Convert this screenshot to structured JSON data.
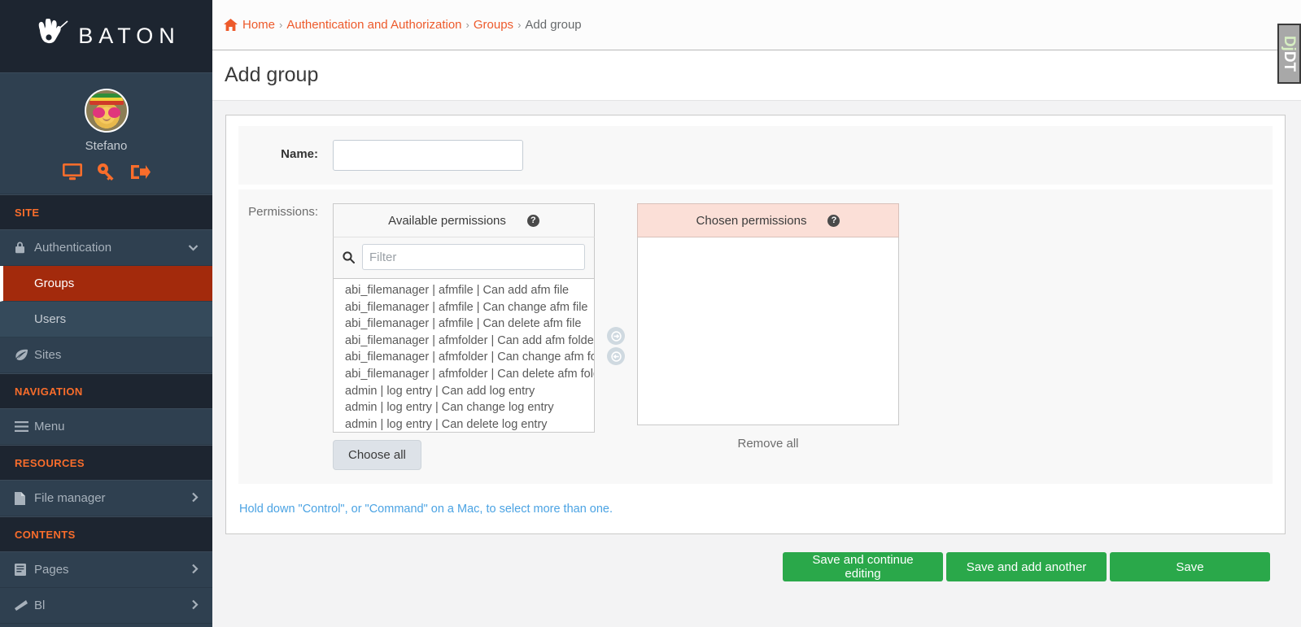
{
  "brand": {
    "name": "BATON",
    "logo_icon": "hand-baton-icon"
  },
  "profile": {
    "name": "Stefano",
    "avatar_icon": "user-avatar",
    "actions": [
      {
        "name": "view-site",
        "icon": "monitor-icon"
      },
      {
        "name": "change-password",
        "icon": "key-icon"
      },
      {
        "name": "logout",
        "icon": "sign-out-icon"
      }
    ]
  },
  "sidebar": {
    "sections": [
      {
        "heading": "SITE",
        "items": [
          {
            "label": "Authentication",
            "icon": "lock-icon",
            "caret": "chevron-down-icon",
            "expanded": true,
            "children": [
              {
                "label": "Groups",
                "active": true
              },
              {
                "label": "Users",
                "active": false
              }
            ]
          },
          {
            "label": "Sites",
            "icon": "leaf-icon",
            "caret": "",
            "children": []
          }
        ]
      },
      {
        "heading": "NAVIGATION",
        "items": [
          {
            "label": "Menu",
            "icon": "bars-icon",
            "caret": "",
            "children": []
          }
        ]
      },
      {
        "heading": "RESOURCES",
        "items": [
          {
            "label": "File manager",
            "icon": "file-icon",
            "caret": "chevron-right-icon",
            "children": []
          }
        ]
      },
      {
        "heading": "CONTENTS",
        "items": [
          {
            "label": "Pages",
            "icon": "book-icon",
            "caret": "chevron-right-icon",
            "children": []
          },
          {
            "label": "Bl",
            "icon": "flag-icon",
            "caret": "chevron-right-icon",
            "children": []
          }
        ]
      }
    ]
  },
  "breadcrumb": {
    "home_icon": "home-icon",
    "items": [
      {
        "label": "Home",
        "current": false
      },
      {
        "label": "Authentication and Authorization",
        "current": false
      },
      {
        "label": "Groups",
        "current": false
      },
      {
        "label": "Add  group",
        "current": true
      }
    ],
    "separator": "›"
  },
  "page": {
    "title": "Add group"
  },
  "form": {
    "name_field": {
      "label": "Name:",
      "value": "",
      "placeholder": ""
    },
    "permissions": {
      "label": "Permissions:",
      "available": {
        "title": "Available permissions",
        "help_icon": "question-circle-icon",
        "filter_icon": "search-icon",
        "filter_value": "",
        "filter_placeholder": "Filter",
        "options": [
          "abi_filemanager | afmfile | Can add afm file",
          "abi_filemanager | afmfile | Can change afm file",
          "abi_filemanager | afmfile | Can delete afm file",
          "abi_filemanager | afmfolder | Can add afm folder",
          "abi_filemanager | afmfolder | Can change afm folder",
          "abi_filemanager | afmfolder | Can delete afm folder",
          "admin | log entry | Can add log entry",
          "admin | log entry | Can change log entry",
          "admin | log entry | Can delete log entry"
        ],
        "choose_all_label": "Choose all"
      },
      "arrows": {
        "add_icon": "arrow-right-circle-icon",
        "remove_icon": "arrow-left-circle-icon"
      },
      "chosen": {
        "title": "Chosen permissions",
        "help_icon": "question-circle-icon",
        "options": [],
        "remove_all_label": "Remove all",
        "header_color": "#fbdfd7"
      },
      "help_text": "Hold down \"Control\", or \"Command\" on a Mac, to select more than one."
    }
  },
  "actions": {
    "save_continue": "Save and continue editing",
    "save_add_another": "Save and add another",
    "save": "Save",
    "color": "#2aa84a"
  },
  "debug_toolbar": {
    "label_dj": "Dj",
    "label_dt": "DT"
  },
  "colors": {
    "sidebar_bg": "#2f4050",
    "sidebar_brand_bg": "#1d2530",
    "accent_orange": "#f96d2b",
    "active_item": "#a32a0c",
    "link_blue": "#4ba3e3",
    "breadcrumb_link": "#ed5a2b"
  }
}
